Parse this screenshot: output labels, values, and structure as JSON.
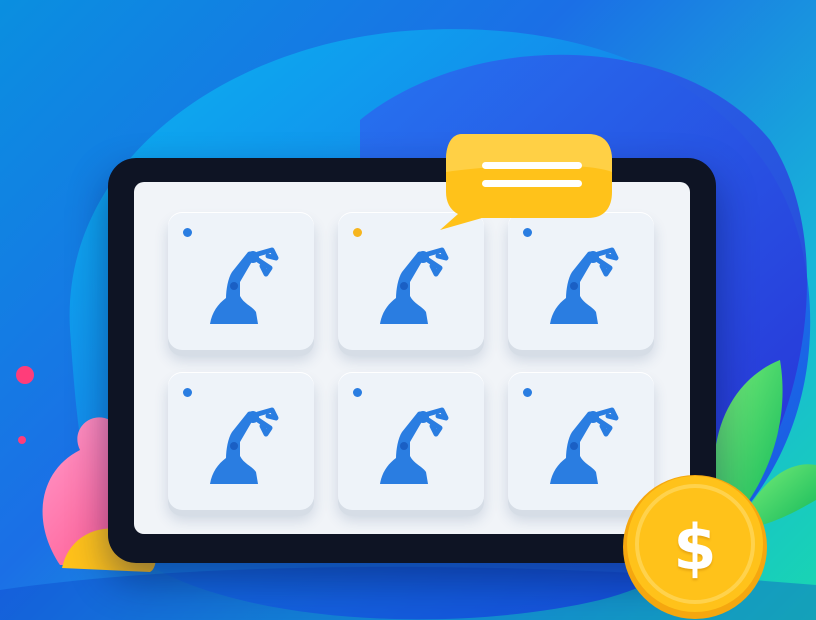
{
  "illustration": {
    "colors": {
      "background_start": "#0a8fe0",
      "background_end": "#19d7b0",
      "tablet_frame": "#0e1424",
      "screen": "#f1f4f8",
      "robot_arm": "#2a7de1",
      "status_dot_default": "#2a7de1",
      "status_dot_alert": "#f6b51e",
      "chat_bubble": "#ffc21a",
      "coin": "#ffc21a",
      "leaf": "#1fd06a",
      "coral_plant": "#ff5a9a"
    },
    "chat_bubble_icon": "chat-bubble-icon",
    "coin": {
      "symbol": "$",
      "icon": "dollar-coin-icon"
    },
    "tiles": [
      {
        "icon": "robot-arm-icon",
        "status": "default"
      },
      {
        "icon": "robot-arm-icon",
        "status": "alert"
      },
      {
        "icon": "robot-arm-icon",
        "status": "default"
      },
      {
        "icon": "robot-arm-icon",
        "status": "default"
      },
      {
        "icon": "robot-arm-icon",
        "status": "default"
      },
      {
        "icon": "robot-arm-icon",
        "status": "default"
      }
    ]
  }
}
